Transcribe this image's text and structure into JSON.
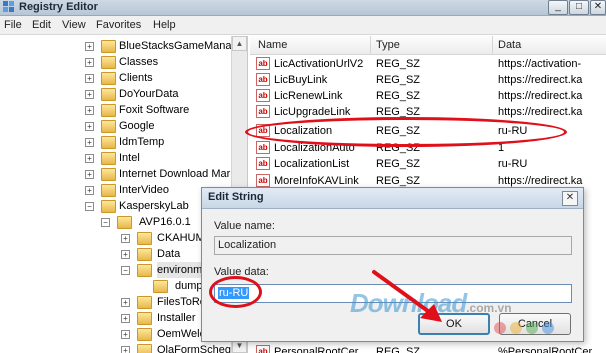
{
  "window": {
    "title": "Registry Editor",
    "minimize": "_",
    "maximize": "□"
  },
  "menu": [
    "File",
    "Edit",
    "View",
    "Favorites",
    "Help"
  ],
  "tree": {
    "nodes": [
      {
        "label": "BlueStacksGameManag",
        "expanded": false
      },
      {
        "label": "Classes",
        "expanded": false
      },
      {
        "label": "Clients",
        "expanded": false
      },
      {
        "label": "DoYourData",
        "expanded": false
      },
      {
        "label": "Foxit Software",
        "expanded": false
      },
      {
        "label": "Google",
        "expanded": false
      },
      {
        "label": "IdmTemp",
        "expanded": false
      },
      {
        "label": "Intel",
        "expanded": false
      },
      {
        "label": "Internet Download Mar",
        "expanded": false
      },
      {
        "label": "InterVideo",
        "expanded": false
      },
      {
        "label": "KasperskyLab",
        "expanded": true
      },
      {
        "label": "AVP16.0.1",
        "expanded": true
      },
      {
        "label": "CKAHUM",
        "expanded": false
      },
      {
        "label": "Data",
        "expanded": false
      },
      {
        "label": "environm",
        "expanded": true
      },
      {
        "label": "dump",
        "expanded": false
      },
      {
        "label": "FilesToRe",
        "expanded": false
      },
      {
        "label": "Installer",
        "expanded": false
      },
      {
        "label": "OemWelc",
        "expanded": false
      },
      {
        "label": "OlaFormScheg",
        "expanded": false
      }
    ]
  },
  "list": {
    "columns": [
      "Name",
      "Type",
      "Data"
    ],
    "rows": [
      {
        "name": "LicActivationUrlV2",
        "type": "REG_SZ",
        "data": "https://activation-"
      },
      {
        "name": "LicBuyLink",
        "type": "REG_SZ",
        "data": "https://redirect.ka"
      },
      {
        "name": "LicRenewLink",
        "type": "REG_SZ",
        "data": "https://redirect.ka"
      },
      {
        "name": "LicUpgradeLink",
        "type": "REG_SZ",
        "data": "https://redirect.ka"
      },
      {
        "name": "Localization",
        "type": "REG_SZ",
        "data": "ru-RU"
      },
      {
        "name": "LocalizationAuto",
        "type": "REG_SZ",
        "data": "1"
      },
      {
        "name": "LocalizationList",
        "type": "REG_SZ",
        "data": "ru-RU"
      },
      {
        "name": "MoreInfoKAVLink",
        "type": "REG_SZ",
        "data": "https://redirect.ka"
      },
      {
        "name": "PersonalRootCer",
        "type": "REG_SZ",
        "data": "%PersonalRootCer"
      }
    ],
    "value_icon": "ab"
  },
  "dialog": {
    "title": "Edit String",
    "close": "✕",
    "value_name_label": "Value name:",
    "value_name": "Localization",
    "value_data_label": "Value data:",
    "value_data": "ru-RU",
    "ok": "OK",
    "cancel": "Cancel"
  },
  "watermark": {
    "text": "Download",
    "suffix": ".com.vn"
  },
  "colors": {
    "annotation_red": "#e0101a",
    "selection_blue": "#3399ff"
  }
}
